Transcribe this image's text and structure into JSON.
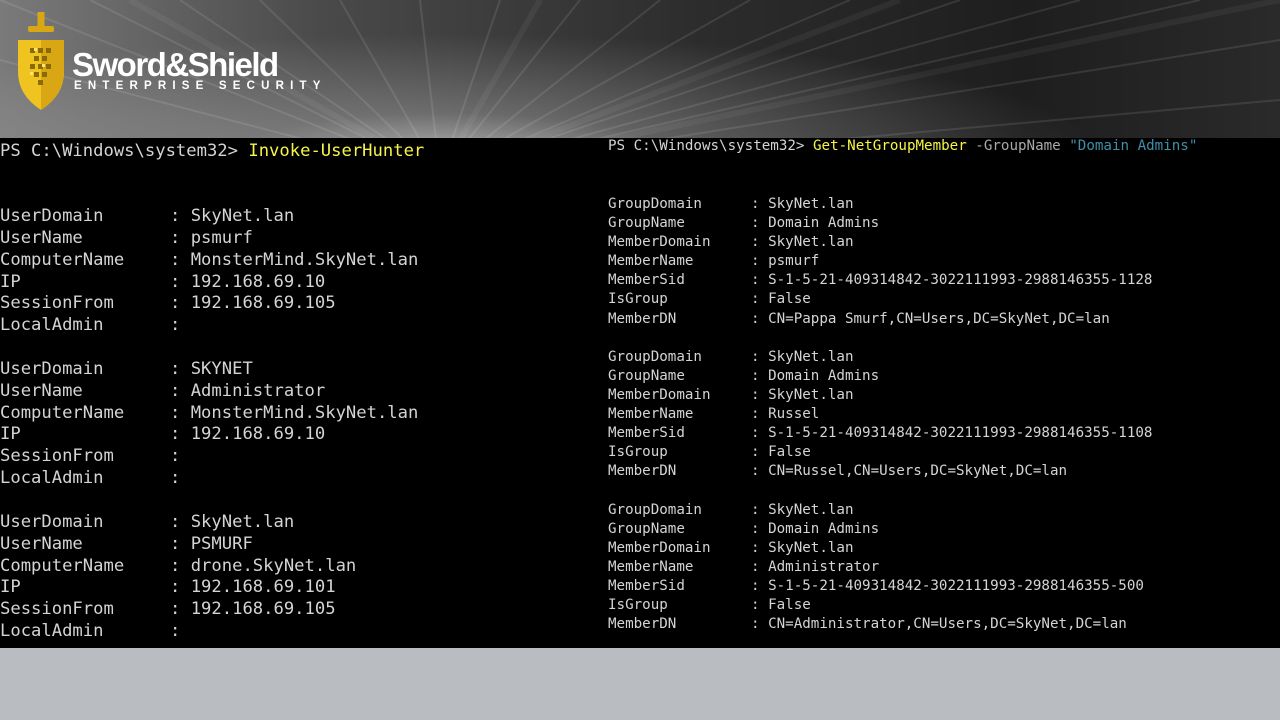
{
  "brand": {
    "name": "Sword&Shield",
    "tagline": "ENTERPRISE SECURITY",
    "colors": {
      "gold": "#f0c420",
      "gold_dark": "#c9980f",
      "white": "#ffffff"
    },
    "icon": "sword-shield-logo-icon"
  },
  "left_terminal": {
    "prompt": "PS C:\\Windows\\system32> ",
    "command": "Invoke-UserHunter",
    "records": [
      [
        {
          "key": "UserDomain",
          "sep": ": ",
          "value": "SkyNet.lan"
        },
        {
          "key": "UserName",
          "sep": ": ",
          "value": "psmurf"
        },
        {
          "key": "ComputerName",
          "sep": ": ",
          "value": "MonsterMind.SkyNet.lan"
        },
        {
          "key": "IP",
          "sep": ": ",
          "value": "192.168.69.10"
        },
        {
          "key": "SessionFrom",
          "sep": ": ",
          "value": "192.168.69.105"
        },
        {
          "key": "LocalAdmin",
          "sep": ":",
          "value": ""
        }
      ],
      [
        {
          "key": "UserDomain",
          "sep": ": ",
          "value": "SKYNET"
        },
        {
          "key": "UserName",
          "sep": ": ",
          "value": "Administrator"
        },
        {
          "key": "ComputerName",
          "sep": ": ",
          "value": "MonsterMind.SkyNet.lan"
        },
        {
          "key": "IP",
          "sep": ": ",
          "value": "192.168.69.10"
        },
        {
          "key": "SessionFrom",
          "sep": ":",
          "value": ""
        },
        {
          "key": "LocalAdmin",
          "sep": ":",
          "value": ""
        }
      ],
      [
        {
          "key": "UserDomain",
          "sep": ": ",
          "value": "SkyNet.lan"
        },
        {
          "key": "UserName",
          "sep": ": ",
          "value": "PSMURF"
        },
        {
          "key": "ComputerName",
          "sep": ": ",
          "value": "drone.SkyNet.lan"
        },
        {
          "key": "IP",
          "sep": ": ",
          "value": "192.168.69.101"
        },
        {
          "key": "SessionFrom",
          "sep": ": ",
          "value": "192.168.69.105"
        },
        {
          "key": "LocalAdmin",
          "sep": ":",
          "value": ""
        }
      ]
    ]
  },
  "right_terminal": {
    "prompt": "PS C:\\Windows\\system32> ",
    "command": "Get-NetGroupMember",
    "param": " -GroupName ",
    "string": "\"Domain Admins\"",
    "records": [
      [
        {
          "key": "GroupDomain",
          "sep": ": ",
          "value": "SkyNet.lan"
        },
        {
          "key": "GroupName",
          "sep": ": ",
          "value": "Domain Admins"
        },
        {
          "key": "MemberDomain",
          "sep": ": ",
          "value": "SkyNet.lan"
        },
        {
          "key": "MemberName",
          "sep": ": ",
          "value": "psmurf"
        },
        {
          "key": "MemberSid",
          "sep": ": ",
          "value": "S-1-5-21-409314842-3022111993-2988146355-1128"
        },
        {
          "key": "IsGroup",
          "sep": ": ",
          "value": "False"
        },
        {
          "key": "MemberDN",
          "sep": ": ",
          "value": "CN=Pappa Smurf,CN=Users,DC=SkyNet,DC=lan"
        }
      ],
      [
        {
          "key": "GroupDomain",
          "sep": ": ",
          "value": "SkyNet.lan"
        },
        {
          "key": "GroupName",
          "sep": ": ",
          "value": "Domain Admins"
        },
        {
          "key": "MemberDomain",
          "sep": ": ",
          "value": "SkyNet.lan"
        },
        {
          "key": "MemberName",
          "sep": ": ",
          "value": "Russel"
        },
        {
          "key": "MemberSid",
          "sep": ": ",
          "value": "S-1-5-21-409314842-3022111993-2988146355-1108"
        },
        {
          "key": "IsGroup",
          "sep": ": ",
          "value": "False"
        },
        {
          "key": "MemberDN",
          "sep": ": ",
          "value": "CN=Russel,CN=Users,DC=SkyNet,DC=lan"
        }
      ],
      [
        {
          "key": "GroupDomain",
          "sep": ": ",
          "value": "SkyNet.lan"
        },
        {
          "key": "GroupName",
          "sep": ": ",
          "value": "Domain Admins"
        },
        {
          "key": "MemberDomain",
          "sep": ": ",
          "value": "SkyNet.lan"
        },
        {
          "key": "MemberName",
          "sep": ": ",
          "value": "Administrator"
        },
        {
          "key": "MemberSid",
          "sep": ": ",
          "value": "S-1-5-21-409314842-3022111993-2988146355-500"
        },
        {
          "key": "IsGroup",
          "sep": ": ",
          "value": "False"
        },
        {
          "key": "MemberDN",
          "sep": ": ",
          "value": "CN=Administrator,CN=Users,DC=SkyNet,DC=lan"
        }
      ]
    ]
  },
  "terminal_colors": {
    "background": "#000000",
    "text": "#d4d4d4",
    "command": "#f5f54a",
    "parameter": "#a9a9a9",
    "string": "#3f8fa8"
  }
}
